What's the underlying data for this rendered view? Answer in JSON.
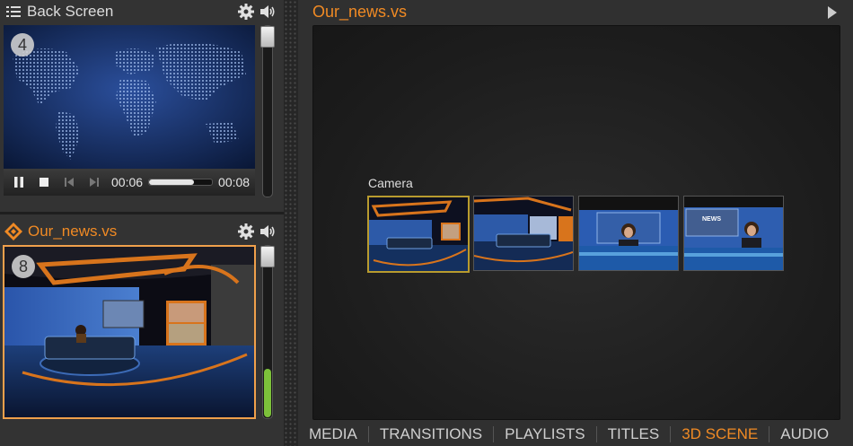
{
  "back_screen": {
    "title": "Back Screen",
    "slot_number": "4",
    "time_current": "00:06",
    "time_total": "00:08",
    "progress": 0.72,
    "volume_level": 0.0
  },
  "scene_preview": {
    "title": "Our_news.vs",
    "slot_number": "8",
    "volume_level": 0.28
  },
  "main_panel": {
    "title": "Our_news.vs",
    "camera_label": "Camera",
    "thumb_news_text": "NEWS"
  },
  "tabs": [
    {
      "label": "MEDIA"
    },
    {
      "label": "TRANSITIONS"
    },
    {
      "label": "PLAYLISTS"
    },
    {
      "label": "TITLES"
    },
    {
      "label": "3D SCENE",
      "active": true
    },
    {
      "label": "AUDIO"
    }
  ],
  "colors": {
    "accent": "#f08a24",
    "panel_bg": "#333333",
    "selection_border": "#b89b2e",
    "volume_green": "#7cc13a"
  },
  "icons": {
    "list": "list-icon",
    "gear": "gear-icon",
    "speaker": "speaker-icon",
    "scene": "scene-diamond-icon",
    "play_arrow": "play-arrow-icon"
  }
}
